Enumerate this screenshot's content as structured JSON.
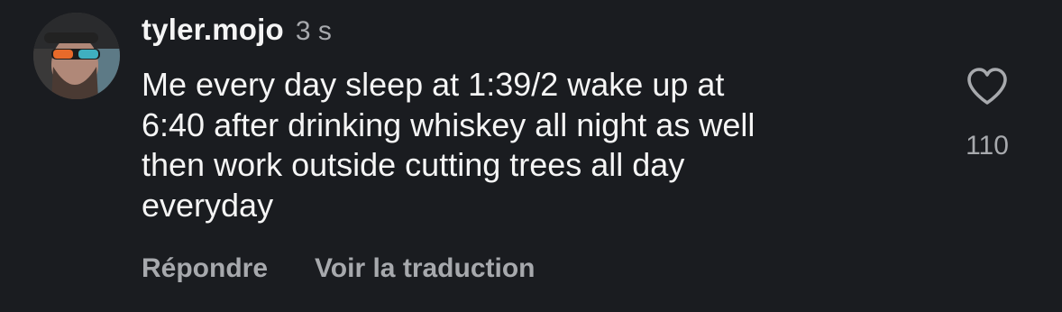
{
  "comment": {
    "username": "tyler.mojo",
    "timestamp": "3 s",
    "text": "Me every day sleep at 1:39/2 wake up at\n6:40 after drinking whiskey all night as well\nthen work outside cutting trees all day\neveryday",
    "reply_label": "Répondre",
    "translate_label": "Voir la traduction",
    "like_count": "110",
    "like_icon": "heart-outline-icon"
  },
  "colors": {
    "background": "#1a1c20",
    "primary_text": "#f5f5f5",
    "secondary_text": "#a7a9ad"
  }
}
